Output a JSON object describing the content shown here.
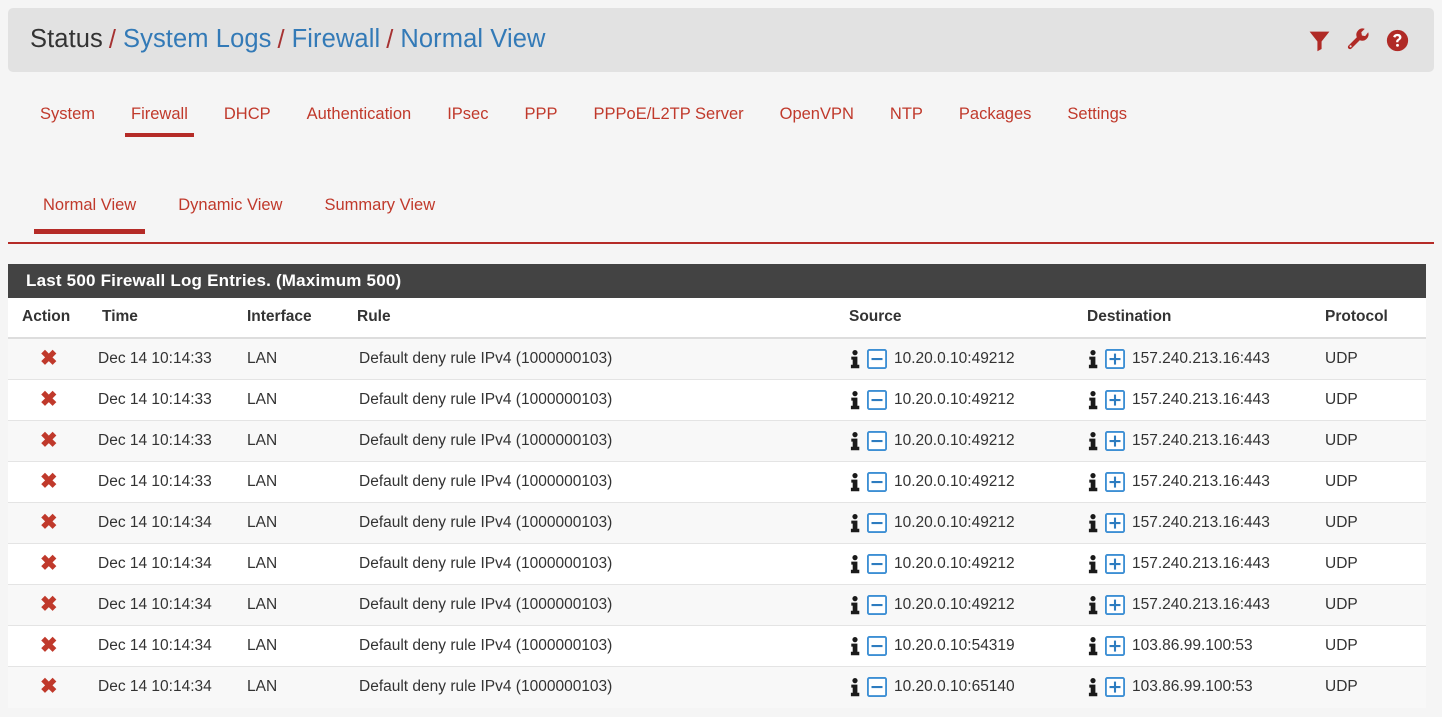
{
  "breadcrumb": {
    "root": "Status",
    "sep": "/",
    "items": [
      "System Logs",
      "Firewall",
      "Normal View"
    ],
    "icons": [
      "filter-icon",
      "wrench-icon",
      "help-icon"
    ],
    "icon_color": "#b02a26"
  },
  "tabs_primary": {
    "items": [
      "System",
      "Firewall",
      "DHCP",
      "Authentication",
      "IPsec",
      "PPP",
      "PPPoE/L2TP Server",
      "OpenVPN",
      "NTP",
      "Packages",
      "Settings"
    ],
    "active": "Firewall"
  },
  "tabs_secondary": {
    "items": [
      "Normal View",
      "Dynamic View",
      "Summary View"
    ],
    "active": "Normal View"
  },
  "panel": {
    "title": "Last 500 Firewall Log Entries. (Maximum 500)",
    "columns": [
      "Action",
      "Time",
      "Interface",
      "Rule",
      "Source",
      "Destination",
      "Protocol"
    ],
    "rows": [
      {
        "action": "✖",
        "action_name": "block",
        "time": "Dec 14 10:14:33",
        "interface": "LAN",
        "rule": "Default deny rule IPv4 (1000000103)",
        "source": "10.20.0.10:49212",
        "destination": "157.240.213.16:443",
        "protocol": "UDP"
      },
      {
        "action": "✖",
        "action_name": "block",
        "time": "Dec 14 10:14:33",
        "interface": "LAN",
        "rule": "Default deny rule IPv4 (1000000103)",
        "source": "10.20.0.10:49212",
        "destination": "157.240.213.16:443",
        "protocol": "UDP"
      },
      {
        "action": "✖",
        "action_name": "block",
        "time": "Dec 14 10:14:33",
        "interface": "LAN",
        "rule": "Default deny rule IPv4 (1000000103)",
        "source": "10.20.0.10:49212",
        "destination": "157.240.213.16:443",
        "protocol": "UDP"
      },
      {
        "action": "✖",
        "action_name": "block",
        "time": "Dec 14 10:14:33",
        "interface": "LAN",
        "rule": "Default deny rule IPv4 (1000000103)",
        "source": "10.20.0.10:49212",
        "destination": "157.240.213.16:443",
        "protocol": "UDP"
      },
      {
        "action": "✖",
        "action_name": "block",
        "time": "Dec 14 10:14:34",
        "interface": "LAN",
        "rule": "Default deny rule IPv4 (1000000103)",
        "source": "10.20.0.10:49212",
        "destination": "157.240.213.16:443",
        "protocol": "UDP"
      },
      {
        "action": "✖",
        "action_name": "block",
        "time": "Dec 14 10:14:34",
        "interface": "LAN",
        "rule": "Default deny rule IPv4 (1000000103)",
        "source": "10.20.0.10:49212",
        "destination": "157.240.213.16:443",
        "protocol": "UDP"
      },
      {
        "action": "✖",
        "action_name": "block",
        "time": "Dec 14 10:14:34",
        "interface": "LAN",
        "rule": "Default deny rule IPv4 (1000000103)",
        "source": "10.20.0.10:49212",
        "destination": "157.240.213.16:443",
        "protocol": "UDP"
      },
      {
        "action": "✖",
        "action_name": "block",
        "time": "Dec 14 10:14:34",
        "interface": "LAN",
        "rule": "Default deny rule IPv4 (1000000103)",
        "source": "10.20.0.10:54319",
        "destination": "103.86.99.100:53",
        "protocol": "UDP"
      },
      {
        "action": "✖",
        "action_name": "block",
        "time": "Dec 14 10:14:34",
        "interface": "LAN",
        "rule": "Default deny rule IPv4 (1000000103)",
        "source": "10.20.0.10:65140",
        "destination": "103.86.99.100:53",
        "protocol": "UDP"
      }
    ],
    "source_icons": [
      "info-icon",
      "minus-box-icon"
    ],
    "destination_icons": [
      "info-icon",
      "plus-box-icon"
    ]
  },
  "colors": {
    "accent_red": "#b52b27",
    "link_blue": "#337ab7",
    "icon_blue": "#337ab7",
    "panel_header_bg": "#434343",
    "page_bg": "#f5f5f5"
  }
}
